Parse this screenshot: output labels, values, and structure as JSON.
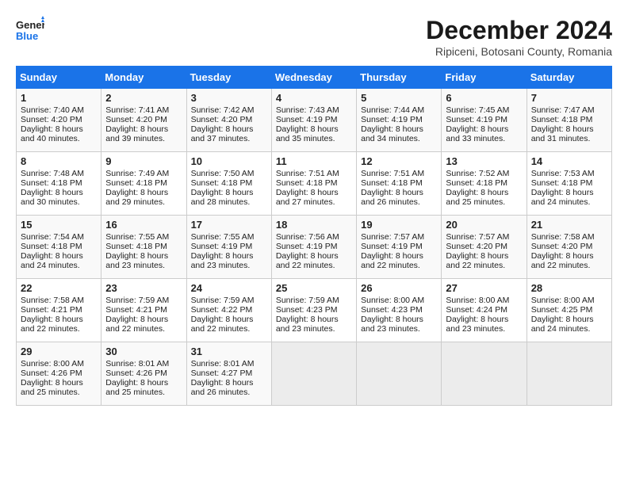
{
  "header": {
    "logo_line1": "General",
    "logo_line2": "Blue",
    "title": "December 2024",
    "location": "Ripiceni, Botosani County, Romania"
  },
  "days_of_week": [
    "Sunday",
    "Monday",
    "Tuesday",
    "Wednesday",
    "Thursday",
    "Friday",
    "Saturday"
  ],
  "weeks": [
    [
      {
        "day": "1",
        "sunrise": "Sunrise: 7:40 AM",
        "sunset": "Sunset: 4:20 PM",
        "daylight": "Daylight: 8 hours and 40 minutes."
      },
      {
        "day": "2",
        "sunrise": "Sunrise: 7:41 AM",
        "sunset": "Sunset: 4:20 PM",
        "daylight": "Daylight: 8 hours and 39 minutes."
      },
      {
        "day": "3",
        "sunrise": "Sunrise: 7:42 AM",
        "sunset": "Sunset: 4:20 PM",
        "daylight": "Daylight: 8 hours and 37 minutes."
      },
      {
        "day": "4",
        "sunrise": "Sunrise: 7:43 AM",
        "sunset": "Sunset: 4:19 PM",
        "daylight": "Daylight: 8 hours and 35 minutes."
      },
      {
        "day": "5",
        "sunrise": "Sunrise: 7:44 AM",
        "sunset": "Sunset: 4:19 PM",
        "daylight": "Daylight: 8 hours and 34 minutes."
      },
      {
        "day": "6",
        "sunrise": "Sunrise: 7:45 AM",
        "sunset": "Sunset: 4:19 PM",
        "daylight": "Daylight: 8 hours and 33 minutes."
      },
      {
        "day": "7",
        "sunrise": "Sunrise: 7:47 AM",
        "sunset": "Sunset: 4:18 PM",
        "daylight": "Daylight: 8 hours and 31 minutes."
      }
    ],
    [
      {
        "day": "8",
        "sunrise": "Sunrise: 7:48 AM",
        "sunset": "Sunset: 4:18 PM",
        "daylight": "Daylight: 8 hours and 30 minutes."
      },
      {
        "day": "9",
        "sunrise": "Sunrise: 7:49 AM",
        "sunset": "Sunset: 4:18 PM",
        "daylight": "Daylight: 8 hours and 29 minutes."
      },
      {
        "day": "10",
        "sunrise": "Sunrise: 7:50 AM",
        "sunset": "Sunset: 4:18 PM",
        "daylight": "Daylight: 8 hours and 28 minutes."
      },
      {
        "day": "11",
        "sunrise": "Sunrise: 7:51 AM",
        "sunset": "Sunset: 4:18 PM",
        "daylight": "Daylight: 8 hours and 27 minutes."
      },
      {
        "day": "12",
        "sunrise": "Sunrise: 7:51 AM",
        "sunset": "Sunset: 4:18 PM",
        "daylight": "Daylight: 8 hours and 26 minutes."
      },
      {
        "day": "13",
        "sunrise": "Sunrise: 7:52 AM",
        "sunset": "Sunset: 4:18 PM",
        "daylight": "Daylight: 8 hours and 25 minutes."
      },
      {
        "day": "14",
        "sunrise": "Sunrise: 7:53 AM",
        "sunset": "Sunset: 4:18 PM",
        "daylight": "Daylight: 8 hours and 24 minutes."
      }
    ],
    [
      {
        "day": "15",
        "sunrise": "Sunrise: 7:54 AM",
        "sunset": "Sunset: 4:18 PM",
        "daylight": "Daylight: 8 hours and 24 minutes."
      },
      {
        "day": "16",
        "sunrise": "Sunrise: 7:55 AM",
        "sunset": "Sunset: 4:18 PM",
        "daylight": "Daylight: 8 hours and 23 minutes."
      },
      {
        "day": "17",
        "sunrise": "Sunrise: 7:55 AM",
        "sunset": "Sunset: 4:19 PM",
        "daylight": "Daylight: 8 hours and 23 minutes."
      },
      {
        "day": "18",
        "sunrise": "Sunrise: 7:56 AM",
        "sunset": "Sunset: 4:19 PM",
        "daylight": "Daylight: 8 hours and 22 minutes."
      },
      {
        "day": "19",
        "sunrise": "Sunrise: 7:57 AM",
        "sunset": "Sunset: 4:19 PM",
        "daylight": "Daylight: 8 hours and 22 minutes."
      },
      {
        "day": "20",
        "sunrise": "Sunrise: 7:57 AM",
        "sunset": "Sunset: 4:20 PM",
        "daylight": "Daylight: 8 hours and 22 minutes."
      },
      {
        "day": "21",
        "sunrise": "Sunrise: 7:58 AM",
        "sunset": "Sunset: 4:20 PM",
        "daylight": "Daylight: 8 hours and 22 minutes."
      }
    ],
    [
      {
        "day": "22",
        "sunrise": "Sunrise: 7:58 AM",
        "sunset": "Sunset: 4:21 PM",
        "daylight": "Daylight: 8 hours and 22 minutes."
      },
      {
        "day": "23",
        "sunrise": "Sunrise: 7:59 AM",
        "sunset": "Sunset: 4:21 PM",
        "daylight": "Daylight: 8 hours and 22 minutes."
      },
      {
        "day": "24",
        "sunrise": "Sunrise: 7:59 AM",
        "sunset": "Sunset: 4:22 PM",
        "daylight": "Daylight: 8 hours and 22 minutes."
      },
      {
        "day": "25",
        "sunrise": "Sunrise: 7:59 AM",
        "sunset": "Sunset: 4:23 PM",
        "daylight": "Daylight: 8 hours and 23 minutes."
      },
      {
        "day": "26",
        "sunrise": "Sunrise: 8:00 AM",
        "sunset": "Sunset: 4:23 PM",
        "daylight": "Daylight: 8 hours and 23 minutes."
      },
      {
        "day": "27",
        "sunrise": "Sunrise: 8:00 AM",
        "sunset": "Sunset: 4:24 PM",
        "daylight": "Daylight: 8 hours and 23 minutes."
      },
      {
        "day": "28",
        "sunrise": "Sunrise: 8:00 AM",
        "sunset": "Sunset: 4:25 PM",
        "daylight": "Daylight: 8 hours and 24 minutes."
      }
    ],
    [
      {
        "day": "29",
        "sunrise": "Sunrise: 8:00 AM",
        "sunset": "Sunset: 4:26 PM",
        "daylight": "Daylight: 8 hours and 25 minutes."
      },
      {
        "day": "30",
        "sunrise": "Sunrise: 8:01 AM",
        "sunset": "Sunset: 4:26 PM",
        "daylight": "Daylight: 8 hours and 25 minutes."
      },
      {
        "day": "31",
        "sunrise": "Sunrise: 8:01 AM",
        "sunset": "Sunset: 4:27 PM",
        "daylight": "Daylight: 8 hours and 26 minutes."
      },
      null,
      null,
      null,
      null
    ]
  ]
}
